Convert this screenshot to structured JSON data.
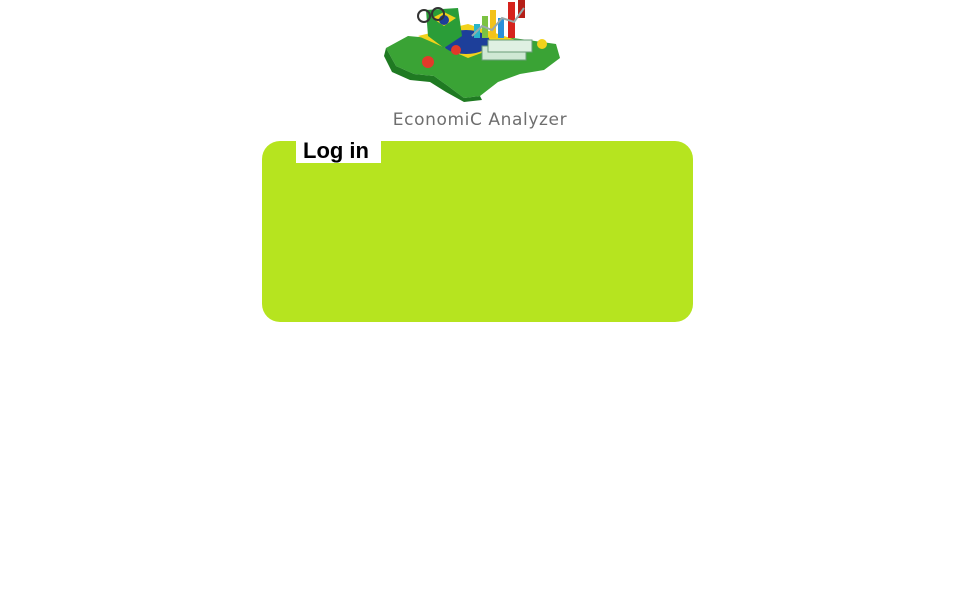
{
  "brand": {
    "name": "EconomiC Analyzer",
    "logo_icon": "brazil-economy-logo-icon"
  },
  "login": {
    "title": "Log in",
    "panel_color": "#b6e41f"
  }
}
